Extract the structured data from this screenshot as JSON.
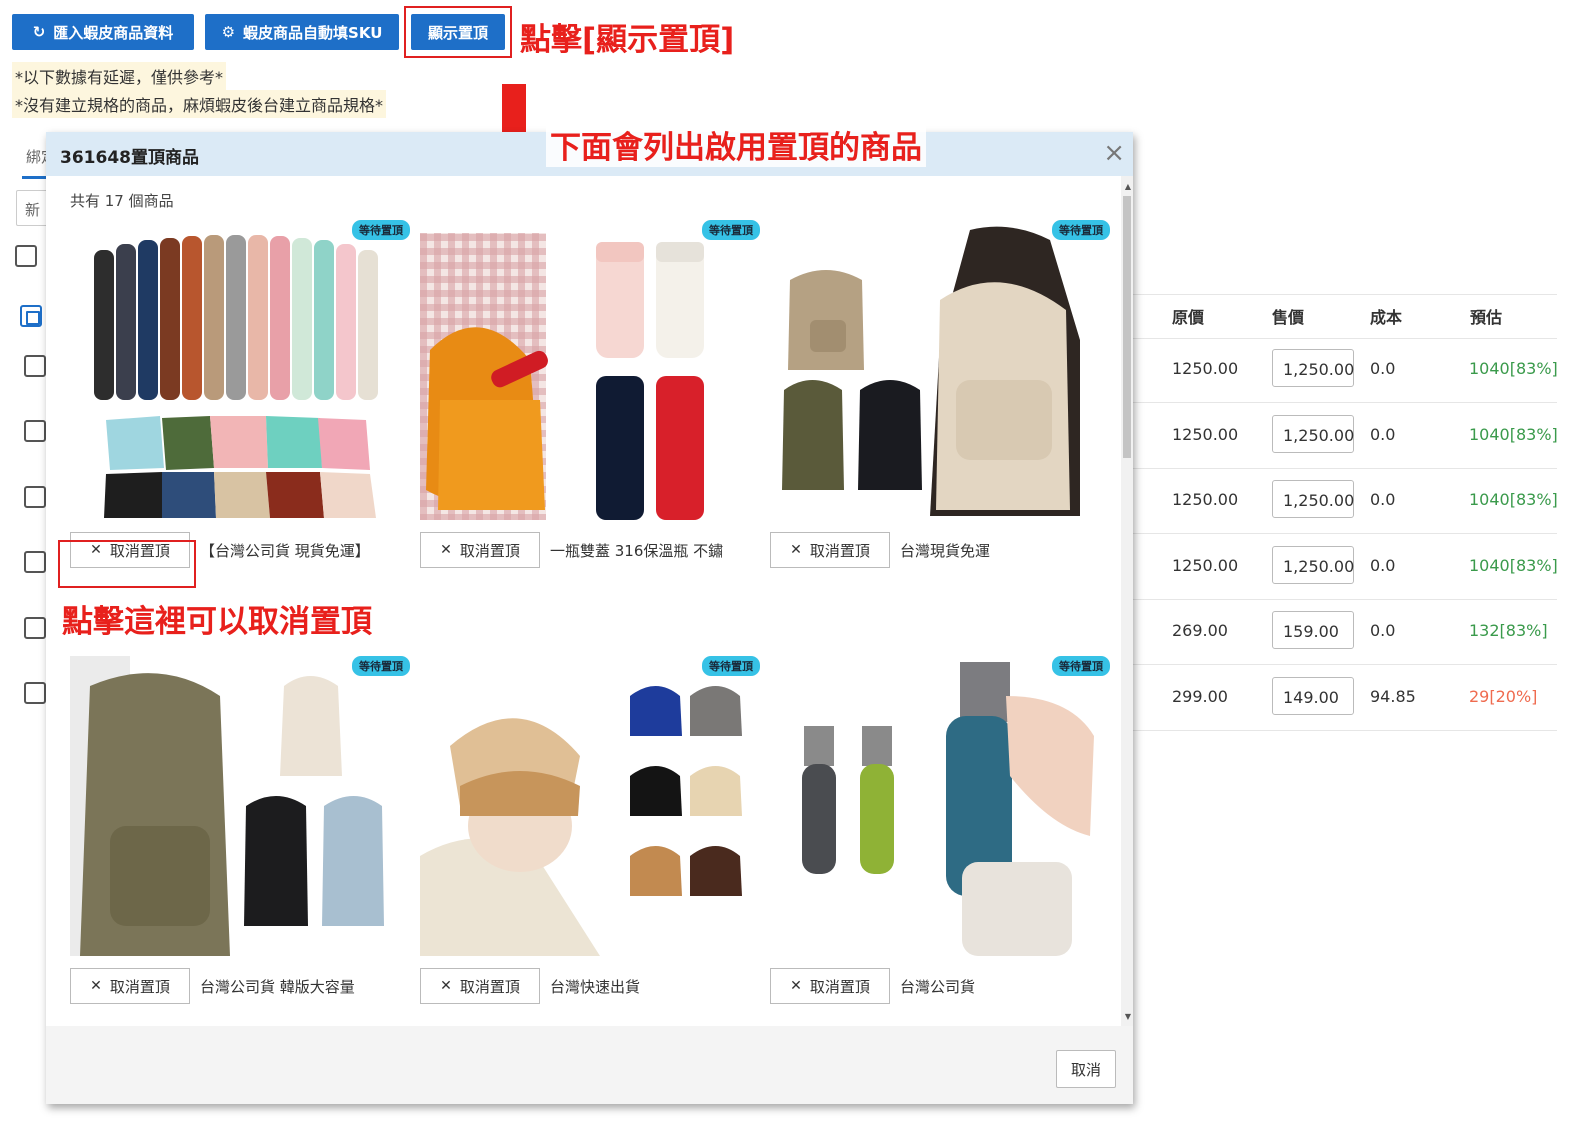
{
  "toolbar": {
    "import_label": "匯入蝦皮商品資料",
    "autofill_label": "蝦皮商品自動填SKU",
    "show_pinned_label": "顯示置頂"
  },
  "notes": [
    "*以下數據有延遲，僅供參考*",
    "*沒有建立規格的商品，麻煩蝦皮後台建立商品規格*"
  ],
  "annotations": {
    "click_show_pinned": "點擊[顯示置頂]",
    "list_below": "下面會列出啟用置頂的商品",
    "click_cancel": "點擊這裡可以取消置頂"
  },
  "background": {
    "tab_label": "綁定",
    "input_text": "新",
    "table_headers": [
      "原價",
      "售價",
      "成本",
      "預估"
    ],
    "rows": [
      {
        "original": "1250.00",
        "price": "1,250.00",
        "cost": "0.0",
        "estimate": "1040[83%]",
        "estimate_color": "#3a9a4b"
      },
      {
        "original": "1250.00",
        "price": "1,250.00",
        "cost": "0.0",
        "estimate": "1040[83%]",
        "estimate_color": "#3a9a4b"
      },
      {
        "original": "1250.00",
        "price": "1,250.00",
        "cost": "0.0",
        "estimate": "1040[83%]",
        "estimate_color": "#3a9a4b"
      },
      {
        "original": "1250.00",
        "price": "1,250.00",
        "cost": "0.0",
        "estimate": "1040[83%]",
        "estimate_color": "#3a9a4b"
      },
      {
        "original": "269.00",
        "price": "159.00",
        "cost": "0.0",
        "estimate": "132[83%]",
        "estimate_color": "#3a9a4b"
      },
      {
        "original": "299.00",
        "price": "149.00",
        "cost": "94.85",
        "estimate": "29[20%]",
        "estimate_color": "#ef6b4f"
      }
    ]
  },
  "modal": {
    "title": "361648置頂商品",
    "count_text": "共有 17 個商品",
    "cancel_footer": "取消",
    "products": [
      {
        "badge": "等待置頂",
        "cancel_label": "取消置頂",
        "name": "【台灣公司貨 現貨免運】",
        "image": "desk-mats"
      },
      {
        "badge": "等待置頂",
        "cancel_label": "取消置頂",
        "name": "一瓶雙蓋 316保溫瓶 不鏽",
        "image": "thermos-bottles"
      },
      {
        "badge": "等待置頂",
        "cancel_label": "取消置頂",
        "name": "台灣現貨免運",
        "image": "canvas-backpacks"
      },
      {
        "badge": "等待置頂",
        "cancel_label": "取消置頂",
        "name": "台灣公司貨 韓版大容量",
        "image": "school-backpacks"
      },
      {
        "badge": "等待置頂",
        "cancel_label": "取消置頂",
        "name": "台灣快速出貨",
        "image": "knit-beanies"
      },
      {
        "badge": "等待置頂",
        "cancel_label": "取消置頂",
        "name": "台灣公司貨",
        "image": "cup-brushes"
      }
    ]
  },
  "colors": {
    "primary": "#1e6fc8",
    "annotation_red": "#e8201c",
    "badge": "#36c2e6",
    "modal_header": "#dbeaf6"
  }
}
